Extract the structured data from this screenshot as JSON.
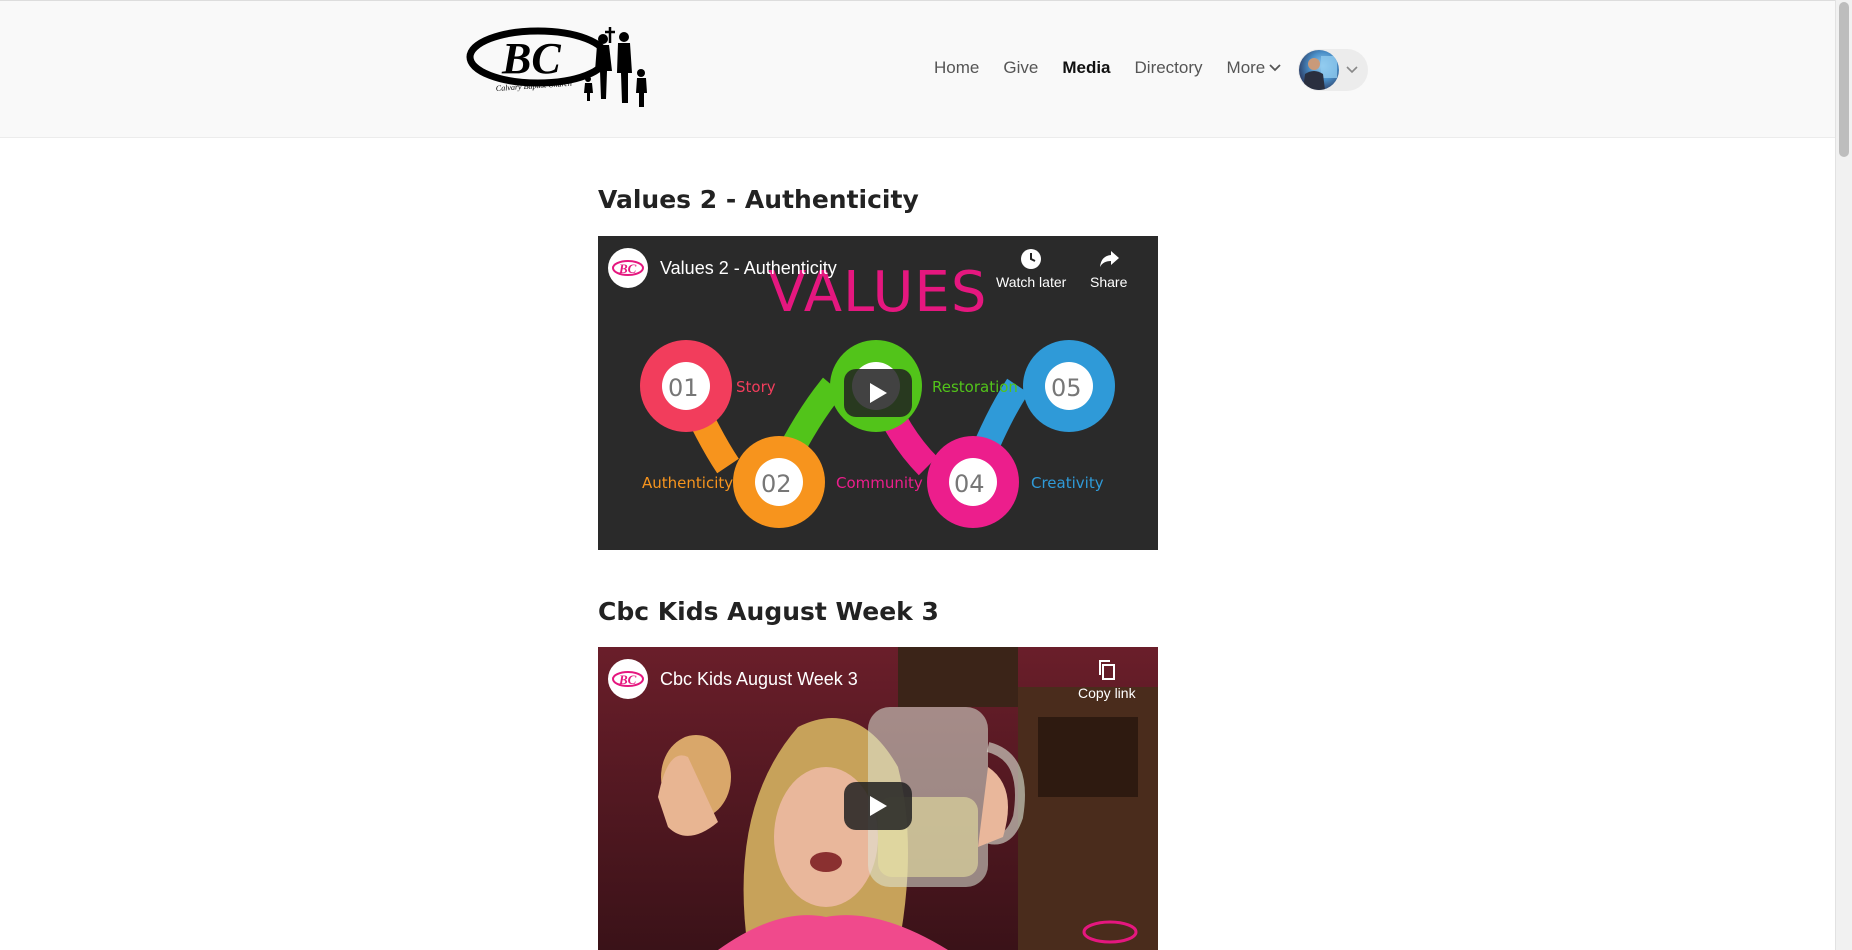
{
  "site": {
    "logo_text": "BC",
    "logo_subtext": "Calvary Baptist Church"
  },
  "nav": {
    "items": [
      {
        "label": "Home",
        "active": false
      },
      {
        "label": "Give",
        "active": false
      },
      {
        "label": "Media",
        "active": true
      },
      {
        "label": "Directory",
        "active": false
      }
    ],
    "more_label": "More"
  },
  "posts": [
    {
      "title": "Values 2 - Authenticity",
      "video": {
        "title": "Values 2 - Authenticity",
        "channel_badge": "BC",
        "actions": [
          "Watch later",
          "Share"
        ],
        "thumb_heading": "VALUES",
        "steps": [
          {
            "num": "01",
            "label": "Story",
            "color": "#f23d5c"
          },
          {
            "num": "02",
            "label": "Authenticity",
            "color": "#f7941d"
          },
          {
            "num": "03",
            "label": "Restoration",
            "color": "#52c41a"
          },
          {
            "num": "04",
            "label": "Community",
            "color": "#ec1e8c"
          },
          {
            "num": "05",
            "label": "Creativity",
            "color": "#2f9ad8"
          }
        ]
      }
    },
    {
      "title": "Cbc Kids August Week 3",
      "video": {
        "title": "Cbc Kids August Week 3",
        "channel_badge": "BC",
        "actions": [
          "Copy link"
        ]
      }
    }
  ],
  "colors": {
    "accent": "#e5177f",
    "header_bg": "#f9f9f9",
    "nav_text": "#555555"
  },
  "icons": {
    "watch_later": "clock-icon",
    "share": "share-arrow-icon",
    "copy_link": "copy-icon",
    "play": "play-icon"
  }
}
